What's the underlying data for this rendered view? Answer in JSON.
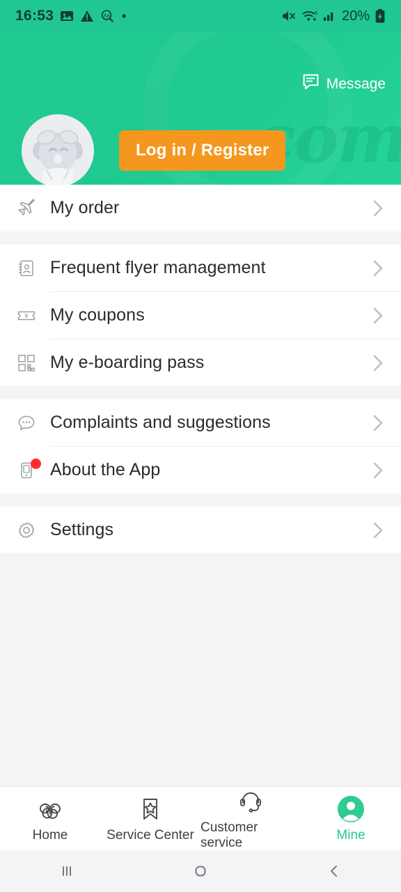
{
  "statusbar": {
    "time": "16:53",
    "battery": "20%",
    "icons": [
      "image-icon",
      "warning-icon",
      "text-magnifier-icon",
      "dot-icon",
      "mute-icon",
      "wifi-icon",
      "cellular-signal-icon",
      "battery-charging-icon"
    ]
  },
  "header": {
    "message_label": "Message",
    "login_label": "Log in / Register",
    "watermark": ".com",
    "bg_color": "#20c792",
    "button_color": "#f5961e"
  },
  "menu": {
    "groups": [
      {
        "items": [
          {
            "label": "My order",
            "icon": "airplane-icon",
            "badge": false
          }
        ]
      },
      {
        "items": [
          {
            "label": "Frequent flyer management",
            "icon": "contact-book-icon",
            "badge": false
          },
          {
            "label": "My coupons",
            "icon": "coupon-ticket-icon",
            "badge": false
          },
          {
            "label": "My e-boarding pass",
            "icon": "qr-code-icon",
            "badge": false
          }
        ]
      },
      {
        "items": [
          {
            "label": "Complaints and suggestions",
            "icon": "chat-bubble-icon",
            "badge": false
          },
          {
            "label": "About the App",
            "icon": "mobile-phone-icon",
            "badge": true
          }
        ]
      },
      {
        "items": [
          {
            "label": "Settings",
            "icon": "gear-icon",
            "badge": false
          }
        ]
      }
    ]
  },
  "tabbar": {
    "active_color": "#27c78f",
    "tabs": [
      {
        "label": "Home",
        "icon": "triple-spiral-icon",
        "active": false
      },
      {
        "label": "Service Center",
        "icon": "bookmark-star-icon",
        "active": false
      },
      {
        "label": "Customer service",
        "icon": "headset-icon",
        "active": false
      },
      {
        "label": "Mine",
        "icon": "user-avatar-icon",
        "active": true
      }
    ]
  },
  "androidnav": {
    "buttons": [
      {
        "name": "recents-icon"
      },
      {
        "name": "home-icon"
      },
      {
        "name": "back-icon"
      }
    ]
  }
}
